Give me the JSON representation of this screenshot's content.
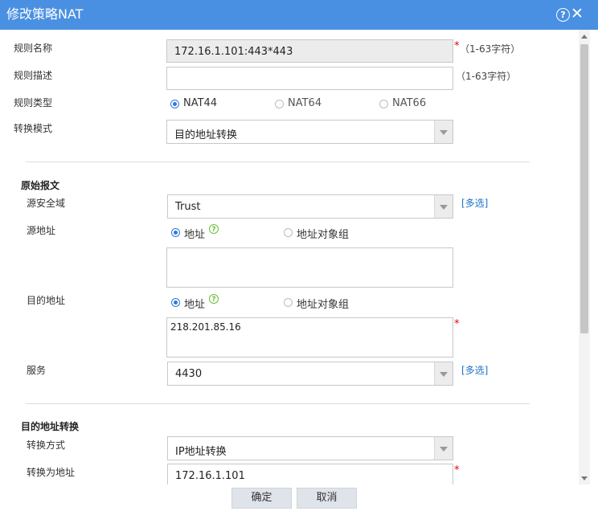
{
  "dialog": {
    "title": "修改策略NAT"
  },
  "icons": {
    "help": "help-icon",
    "close": "close-icon"
  },
  "rule": {
    "name_label": "规则名称",
    "name_value": "172.16.1.101:443*443",
    "name_hint": "（1-63字符）",
    "desc_label": "规则描述",
    "desc_value": "",
    "desc_hint": "（1-63字符）",
    "type_label": "规则类型",
    "type_options": [
      "NAT44",
      "NAT64",
      "NAT66"
    ],
    "type_selected": "NAT44",
    "mode_label": "转换模式",
    "mode_value": "目的地址转换"
  },
  "original": {
    "section_title": "原始报文",
    "src_zone_label": "源安全域",
    "src_zone_value": "Trust",
    "multi_select": "[多选]",
    "src_addr_label": "源地址",
    "addr_option": "地址",
    "addr_group_option": "地址对象组",
    "src_addr_value": "",
    "dst_addr_label": "目的地址",
    "dst_addr_value": "218.201.85.16",
    "service_label": "服务",
    "service_value": "4430"
  },
  "dnat": {
    "section_title": "目的地址转换",
    "method_label": "转换方式",
    "method_value": "IP地址转换",
    "to_addr_label": "转换为地址",
    "to_addr_value": "172.16.1.101"
  },
  "footer": {
    "ok": "确定",
    "cancel": "取消"
  },
  "colors": {
    "titlebar": "#4a90e2",
    "link": "#1a73c9",
    "required": "#e00000",
    "radio_on": "#2d7ad6",
    "help_green": "#6cbf3b"
  }
}
